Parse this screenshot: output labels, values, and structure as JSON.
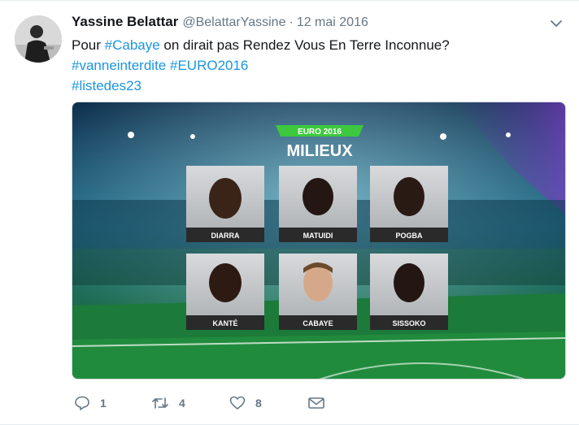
{
  "tweet": {
    "author": {
      "display_name": "Yassine Belattar",
      "handle": "@BelattarYassine"
    },
    "separator": "·",
    "timestamp": "12 mai 2016",
    "text": {
      "prefix": "Pour ",
      "mention_tag": "#Cabaye",
      "suffix": " on dirait pas Rendez Vous En Terre Inconnue?",
      "line2_tag1": "#vanneinterdite",
      "line2_tag2": "#EURO2016",
      "line3_tag": "#listedes23"
    },
    "menu_icon": "chevron-down-icon"
  },
  "media": {
    "banner": "EURO 2016",
    "title": "MILIEUX",
    "players": [
      "DIARRA",
      "MATUIDI",
      "POGBA",
      "KANTÉ",
      "CABAYE",
      "SISSOKO"
    ]
  },
  "actions": {
    "reply": {
      "icon": "reply-icon",
      "count": "1"
    },
    "retweet": {
      "icon": "retweet-icon",
      "count": "4"
    },
    "like": {
      "icon": "heart-icon",
      "count": "8"
    },
    "dm": {
      "icon": "envelope-icon"
    }
  },
  "colors": {
    "link": "#1b95e0",
    "muted": "#657786",
    "banner_green": "#3dc83d",
    "card_label": "#2a2a2a"
  }
}
